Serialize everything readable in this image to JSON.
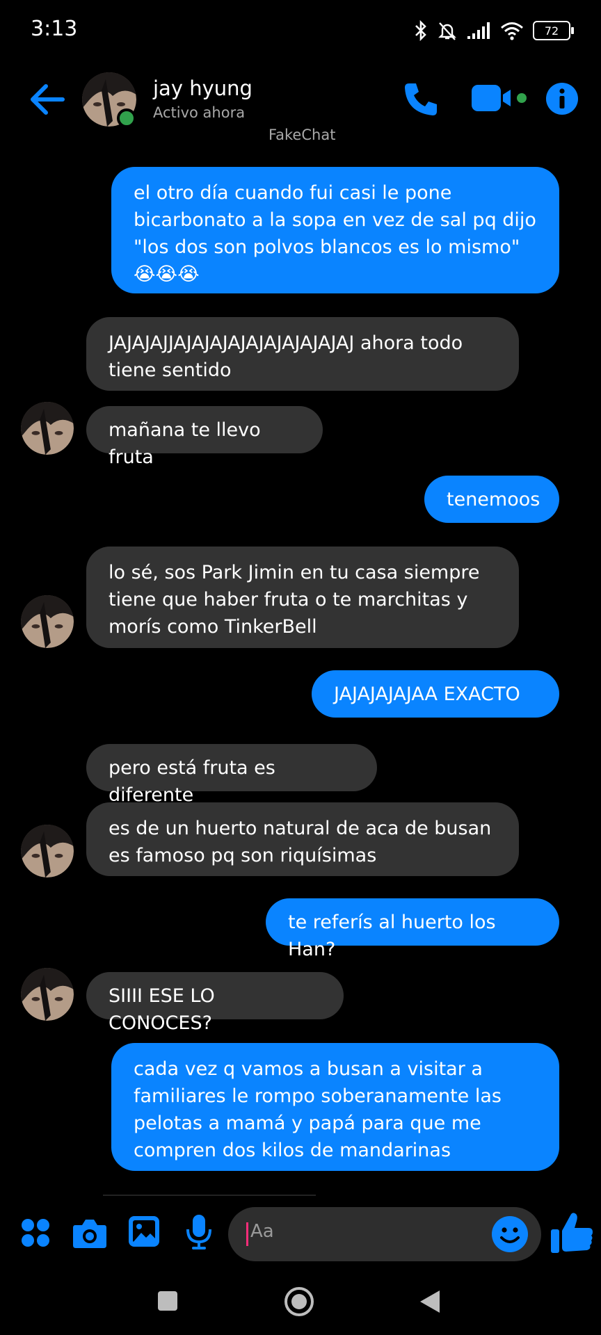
{
  "status_bar": {
    "time": "3:13",
    "battery": "72"
  },
  "header": {
    "name": "jay hyung",
    "status": "Activo ahora",
    "watermark": "FakeChat"
  },
  "messages": [
    {
      "from": "me",
      "text": "el otro día cuando fui casi le pone bicarbonato a la sopa en vez de sal pq dijo \"los dos son polvos blancos es lo mismo\" 😭😭😭"
    },
    {
      "from": "them",
      "text": "JAJAJAJJAJAJAJAJAJAJAJAJAJAJ ahora todo tiene sentido"
    },
    {
      "from": "them",
      "text": "mañana te llevo fruta"
    },
    {
      "from": "me",
      "text": "tenemoos"
    },
    {
      "from": "them",
      "text": "lo sé, sos Park Jimin en tu casa siempre tiene que haber fruta o te marchitas y morís como TinkerBell"
    },
    {
      "from": "me",
      "text": "JAJAJAJAJAA EXACTO"
    },
    {
      "from": "them",
      "text": "pero está fruta es diferente"
    },
    {
      "from": "them",
      "text": "es de un huerto natural de aca de busan es famoso pq son riquísimas"
    },
    {
      "from": "me",
      "text": "te referís al huerto los Han?"
    },
    {
      "from": "them",
      "text": "SIIII ESE LO CONOCES?"
    },
    {
      "from": "me",
      "text": "cada vez q vamos a busan a visitar a familiares le rompo soberanamente las pelotas a mamá y papá para que me compren dos kilos de mandarinas"
    }
  ],
  "composer": {
    "placeholder": "Aa"
  },
  "colors": {
    "accent": "#0a84ff",
    "incoming_bubble": "#333333",
    "online": "#31a24c"
  },
  "icons": {
    "header": [
      "back-arrow-icon",
      "phone-icon",
      "video-camera-icon",
      "info-icon"
    ],
    "composer": [
      "apps-grid-icon",
      "camera-icon",
      "gallery-icon",
      "microphone-icon",
      "emoji-icon",
      "thumbs-up-icon"
    ],
    "navbar": [
      "recents-square-icon",
      "home-circle-icon",
      "back-triangle-icon"
    ]
  }
}
